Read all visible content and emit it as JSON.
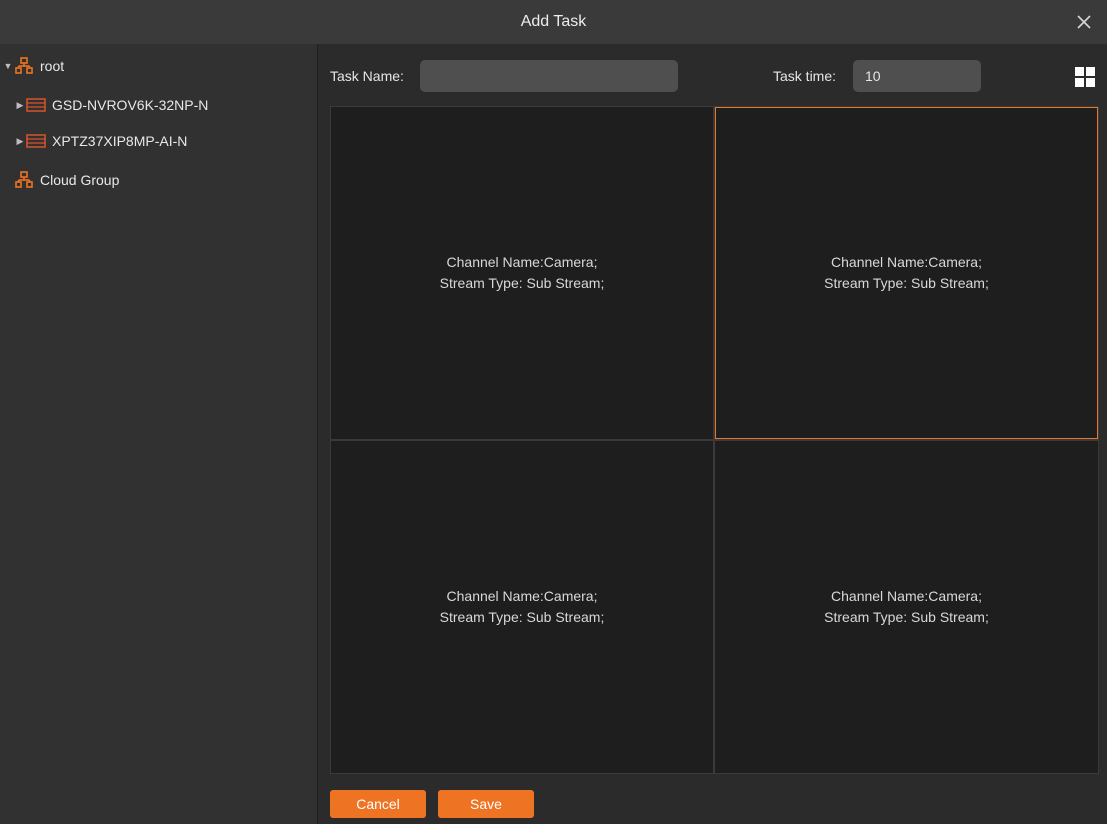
{
  "window": {
    "title": "Add Task"
  },
  "tree": {
    "items": [
      {
        "label": "root",
        "icon": "group-icon"
      },
      {
        "label": "GSD-NVROV6K-32NP-N",
        "icon": "nvr-device-icon"
      },
      {
        "label": "XPTZ37XIP8MP-AI-N",
        "icon": "nvr-device-icon"
      },
      {
        "label": "Cloud Group",
        "icon": "group-icon"
      }
    ]
  },
  "form": {
    "task_name_label": "Task Name:",
    "task_name_value": "",
    "task_time_label": "Task time:",
    "task_time_value": "10"
  },
  "grid": {
    "cells": [
      {
        "channel": "Channel Name:Camera;",
        "stream": "Stream Type: Sub Stream;",
        "selected": false
      },
      {
        "channel": "Channel Name:Camera;",
        "stream": "Stream Type: Sub Stream;",
        "selected": true
      },
      {
        "channel": "Channel Name:Camera;",
        "stream": "Stream Type: Sub Stream;",
        "selected": false
      },
      {
        "channel": "Channel Name:Camera;",
        "stream": "Stream Type: Sub Stream;",
        "selected": false
      }
    ]
  },
  "buttons": {
    "cancel_label": "Cancel",
    "save_label": "Save"
  },
  "colors": {
    "accent": "#ee7322",
    "selected_border": "#e7782a",
    "device_icon": "#d9532b"
  }
}
